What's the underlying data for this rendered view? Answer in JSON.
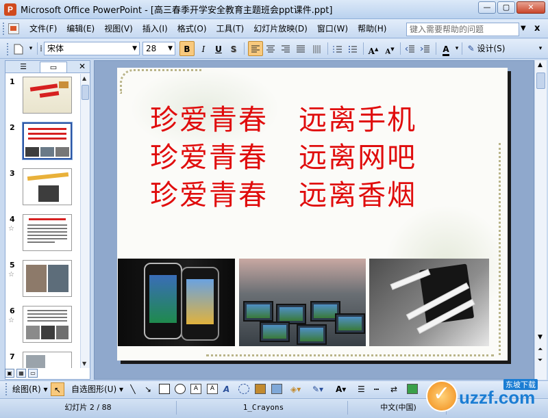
{
  "window": {
    "title": "Microsoft Office PowerPoint - [高三春季开学安全教育主题班会ppt课件.ppt]",
    "minimize": "—",
    "maximize": "▢",
    "close": "✕"
  },
  "menu": {
    "items": [
      "文件(F)",
      "编辑(E)",
      "视图(V)",
      "插入(I)",
      "格式(O)",
      "工具(T)",
      "幻灯片放映(D)",
      "窗口(W)",
      "帮助(H)"
    ],
    "help_placeholder": "键入需要帮助的问题",
    "close_glyph": "x"
  },
  "toolbar": {
    "font_name": "宋体",
    "font_size": "28",
    "bold": "B",
    "italic": "I",
    "underline": "U",
    "shadow": "S",
    "grow_font": "A",
    "shrink_font": "A",
    "font_color": "A",
    "design_label": "设计(S)",
    "icons": [
      "new-icon",
      "bold-icon",
      "italic-icon",
      "underline-icon",
      "shadow-icon",
      "align-left-icon",
      "align-center-icon",
      "align-right-icon",
      "distribute-icon",
      "numbering-icon",
      "bullets-icon",
      "grow-font-icon",
      "shrink-font-icon",
      "decrease-indent-icon",
      "increase-indent-icon",
      "font-color-icon",
      "design-icon"
    ]
  },
  "left_pane": {
    "tabs": [
      "outline-tab",
      "slides-tab"
    ],
    "close_glyph": "✕",
    "thumbnails": [
      {
        "num": "1",
        "star": ""
      },
      {
        "num": "2",
        "star": ""
      },
      {
        "num": "3",
        "star": ""
      },
      {
        "num": "4",
        "star": "☆"
      },
      {
        "num": "5",
        "star": "☆"
      },
      {
        "num": "6",
        "star": "☆"
      },
      {
        "num": "7",
        "star": ""
      }
    ],
    "selected_index": 1
  },
  "slide": {
    "lines": [
      "珍爱青春   远离手机",
      "珍爱青春   远离网吧",
      "珍爱青春   远离香烟"
    ],
    "text_color": "#e00d0d",
    "photos": [
      "smartphones-photo",
      "internet-cafe-photo",
      "cigarettes-photo"
    ]
  },
  "drawing_toolbar": {
    "draw_label": "绘图(R)",
    "autoshapes_label": "自选图形(U)"
  },
  "status": {
    "slide_info": "幻灯片 2 / 88",
    "design": "1_Crayons",
    "language": "中文(中国)"
  },
  "watermark": {
    "text": "uzzf.com",
    "sub": "东坡下载"
  }
}
